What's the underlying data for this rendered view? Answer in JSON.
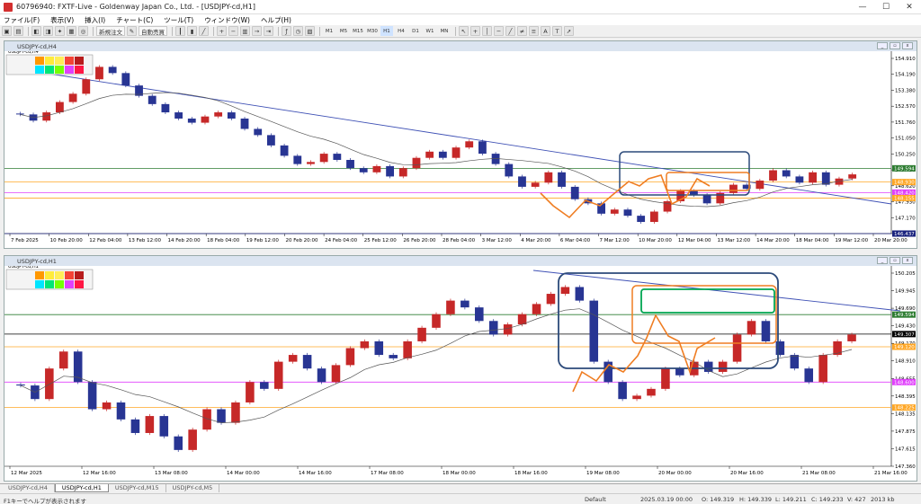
{
  "window": {
    "title": "60796940: FXTF-Live - Goldenway Japan Co., Ltd. - [USDJPY-cd,H1]"
  },
  "menu": [
    "ファイル(F)",
    "表示(V)",
    "挿入(I)",
    "チャート(C)",
    "ツール(T)",
    "ウィンドウ(W)",
    "ヘルプ(H)"
  ],
  "toolbar": {
    "new_order": "新規注文",
    "auto_trading": "自動売買",
    "timeframes": [
      "M1",
      "M5",
      "M15",
      "M30",
      "H1",
      "H4",
      "D1",
      "W1",
      "MN"
    ],
    "active_timeframe": "H1"
  },
  "top_chart": {
    "window_title": "USDJPY-cd,H4",
    "symbol_label": "USDJPY-cd,H4",
    "price_ticks": [
      "154.910",
      "154.190",
      "153.380",
      "152.570",
      "151.760",
      "151.050",
      "150.250",
      "149.430",
      "148.620",
      "147.930",
      "147.170",
      "146.437"
    ],
    "labels": {
      "green": "149.594",
      "orange": "148.930",
      "pink": "148.420",
      "orange2": "148.155",
      "blue": "146.437"
    },
    "time_ticks": [
      "7 Feb 2025",
      "10 Feb 20:00",
      "12 Feb 04:00",
      "13 Feb 12:00",
      "14 Feb 20:00",
      "18 Feb 04:00",
      "19 Feb 12:00",
      "20 Feb 20:00",
      "24 Feb 04:00",
      "25 Feb 12:00",
      "26 Feb 20:00",
      "28 Feb 04:00",
      "3 Mar 12:00",
      "4 Mar 20:00",
      "6 Mar 04:00",
      "7 Mar 12:00",
      "10 Mar 20:00",
      "12 Mar 04:00",
      "13 Mar 12:00",
      "14 Mar 20:00",
      "18 Mar 04:00",
      "19 Mar 12:00",
      "20 Mar 20:00"
    ],
    "chart_data": {
      "type": "candlestick",
      "ylim": [
        146.437,
        154.91
      ],
      "close": [
        152.2,
        151.9,
        152.3,
        152.8,
        153.2,
        153.9,
        154.5,
        154.2,
        153.6,
        153.1,
        152.7,
        152.3,
        152.0,
        151.8,
        152.1,
        152.3,
        152.0,
        151.5,
        151.2,
        150.7,
        150.2,
        149.8,
        149.9,
        150.3,
        150.0,
        149.6,
        149.4,
        149.7,
        149.2,
        149.6,
        150.1,
        150.4,
        150.1,
        150.6,
        150.9,
        150.3,
        149.8,
        149.2,
        148.7,
        148.9,
        149.4,
        148.7,
        148.1,
        147.9,
        147.4,
        147.6,
        147.3,
        147.0,
        147.5,
        148.0,
        148.5,
        148.3,
        147.9,
        148.4,
        148.8,
        148.6,
        149.0,
        149.5,
        149.2,
        148.9,
        149.4,
        148.8,
        149.1,
        149.3
      ]
    }
  },
  "bottom_chart": {
    "window_title": "USDJPY-cd,H1",
    "symbol_label": "USDJPY-cd,H1",
    "price_ticks": [
      "150.205",
      "149.945",
      "149.690",
      "149.430",
      "149.170",
      "148.910",
      "148.655",
      "148.395",
      "148.135",
      "147.875",
      "147.615",
      "147.360"
    ],
    "labels": {
      "green": "149.594",
      "current": "149.307",
      "orange": "149.120",
      "pink": "148.600",
      "orange2": "148.225"
    },
    "time_ticks": [
      "12 Mar 2025",
      "12 Mar 16:00",
      "13 Mar 08:00",
      "14 Mar 00:00",
      "14 Mar 16:00",
      "17 Mar 08:00",
      "18 Mar 00:00",
      "18 Mar 16:00",
      "19 Mar 08:00",
      "20 Mar 00:00",
      "20 Mar 16:00",
      "21 Mar 08:00",
      "21 Mar 16:00"
    ],
    "chart_data": {
      "type": "candlestick",
      "ylim": [
        147.36,
        150.205
      ],
      "close": [
        148.55,
        148.35,
        148.8,
        149.05,
        148.6,
        148.2,
        148.3,
        148.05,
        147.85,
        148.1,
        147.8,
        147.6,
        147.9,
        148.2,
        148.0,
        148.3,
        148.6,
        148.5,
        148.9,
        149.0,
        148.8,
        148.6,
        148.85,
        149.1,
        149.2,
        149.0,
        148.95,
        149.2,
        149.4,
        149.6,
        149.8,
        149.7,
        149.5,
        149.3,
        149.45,
        149.6,
        149.75,
        149.9,
        150.0,
        149.8,
        148.9,
        148.6,
        148.35,
        148.4,
        148.5,
        148.8,
        148.7,
        148.9,
        148.75,
        148.9,
        149.3,
        149.5,
        149.2,
        149.0,
        148.8,
        148.6,
        149.0,
        149.2,
        149.3
      ]
    }
  },
  "tabs": [
    "USDJPY-cd,H4",
    "USDJPY-cd,H1",
    "USDJPY-cd,M15",
    "USDJPY-cd,M5"
  ],
  "active_tab": 1,
  "status": {
    "help": "F1キーでヘルプが表示されます",
    "profile": "Default",
    "datetime": "2025.03.19 00:00",
    "open": "O: 149.319",
    "high": "H: 149.339",
    "low": "L: 149.211",
    "close": "C: 149.233",
    "volume": "V: 427",
    "traffic": "2013 kb"
  }
}
